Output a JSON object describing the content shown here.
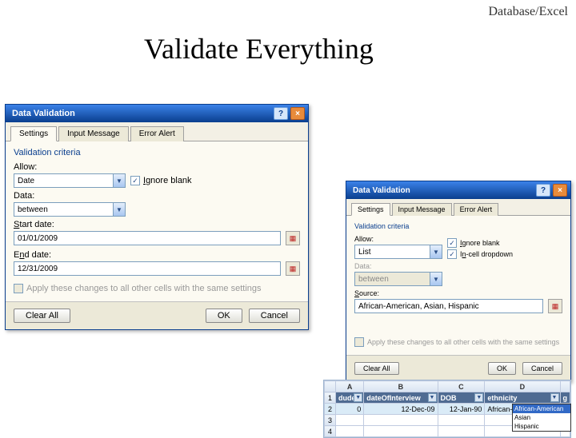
{
  "breadcrumb": "Database/Excel",
  "slide_title": "Validate Everything",
  "dialog1": {
    "title": "Data Validation",
    "tabs": {
      "settings": "Settings",
      "input": "Input Message",
      "error": "Error Alert"
    },
    "section": "Validation criteria",
    "allow_label": "Allow:",
    "allow_value": "Date",
    "ignore_blank": "Ignore blank",
    "data_label": "Data:",
    "data_value": "between",
    "start_label": "Start date:",
    "start_value": "01/01/2009",
    "end_label": "End date:",
    "end_value": "12/31/2009",
    "apply_changes": "Apply these changes to all other cells with the same settings",
    "clear": "Clear All",
    "ok": "OK",
    "cancel": "Cancel"
  },
  "dialog2": {
    "title": "Data Validation",
    "tabs": {
      "settings": "Settings",
      "input": "Input Message",
      "error": "Error Alert"
    },
    "section": "Validation criteria",
    "allow_label": "Allow:",
    "allow_value": "List",
    "ignore_blank": "Ignore blank",
    "incell": "In-cell dropdown",
    "data_label": "Data:",
    "data_value": "between",
    "source_label": "Source:",
    "source_value": "African-American, Asian, Hispanic",
    "apply_changes": "Apply these changes to all other cells with the same settings",
    "clear": "Clear All",
    "ok": "OK",
    "cancel": "Cancel"
  },
  "sheet": {
    "cols": [
      "",
      "A",
      "B",
      "C",
      "D",
      ""
    ],
    "headers": [
      "dude",
      "dateOfInterview",
      "DOB",
      "ethnicity",
      "g"
    ],
    "row2": [
      "0",
      "12-Dec-09",
      "12-Jan-90",
      "African-American",
      ""
    ],
    "dropdown": [
      "African-American",
      "Asian",
      "Hispanic"
    ]
  }
}
